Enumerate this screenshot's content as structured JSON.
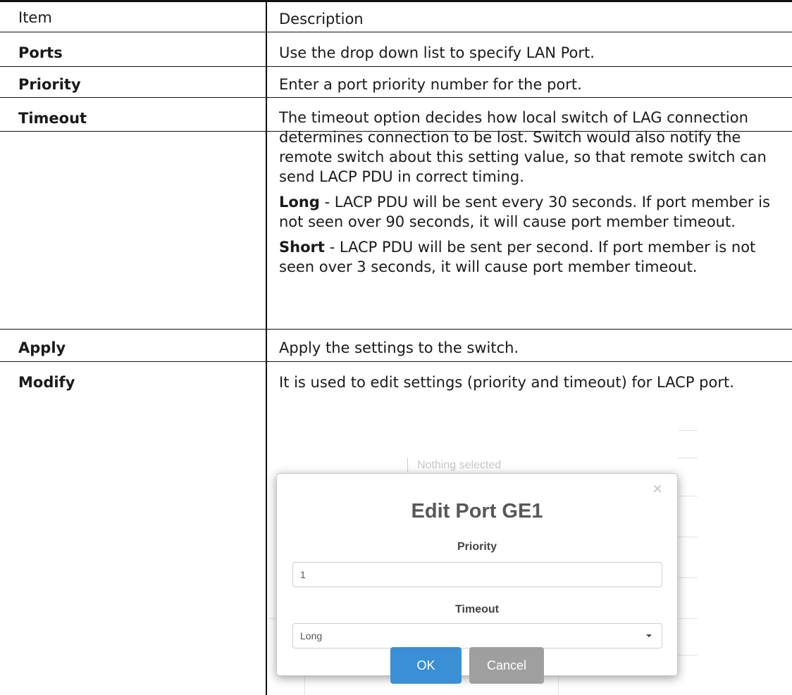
{
  "table": {
    "headers": {
      "item": "Item",
      "description": "Description"
    },
    "rows": [
      {
        "item": "Ports",
        "description": "Use the drop down list to specify LAN Port."
      },
      {
        "item": "Priority",
        "description": "Enter a port priority number for the port."
      },
      {
        "item": "Timeout",
        "description": "The timeout option decides how local switch of LAG connection determines connection to be lost. Switch would also notify the remote switch about this setting value, so that remote switch can send LACP PDU in correct timing.",
        "long_term": "Long",
        "long_text": " - LACP PDU will be sent every 30 seconds. If port member is not seen over 90 seconds, it will cause port member timeout.",
        "short_term": "Short",
        "short_text": " - LACP PDU will be sent per second. If port member is not seen over 3 seconds, it will cause port member timeout."
      },
      {
        "item": "Apply",
        "description": "Apply the settings to the switch."
      },
      {
        "item": "Modify",
        "description": "It is used to edit settings (priority and timeout) for LACP port."
      }
    ]
  },
  "background_hint": "Nothing selected",
  "dialog": {
    "close_glyph": "×",
    "title": "Edit Port GE1",
    "priority_label": "Priority",
    "priority_value": "1",
    "timeout_label": "Timeout",
    "timeout_value": "Long",
    "ok_label": "OK",
    "cancel_label": "Cancel",
    "ok_color": "#3a8fd5",
    "cancel_color": "#9f9f9f"
  }
}
